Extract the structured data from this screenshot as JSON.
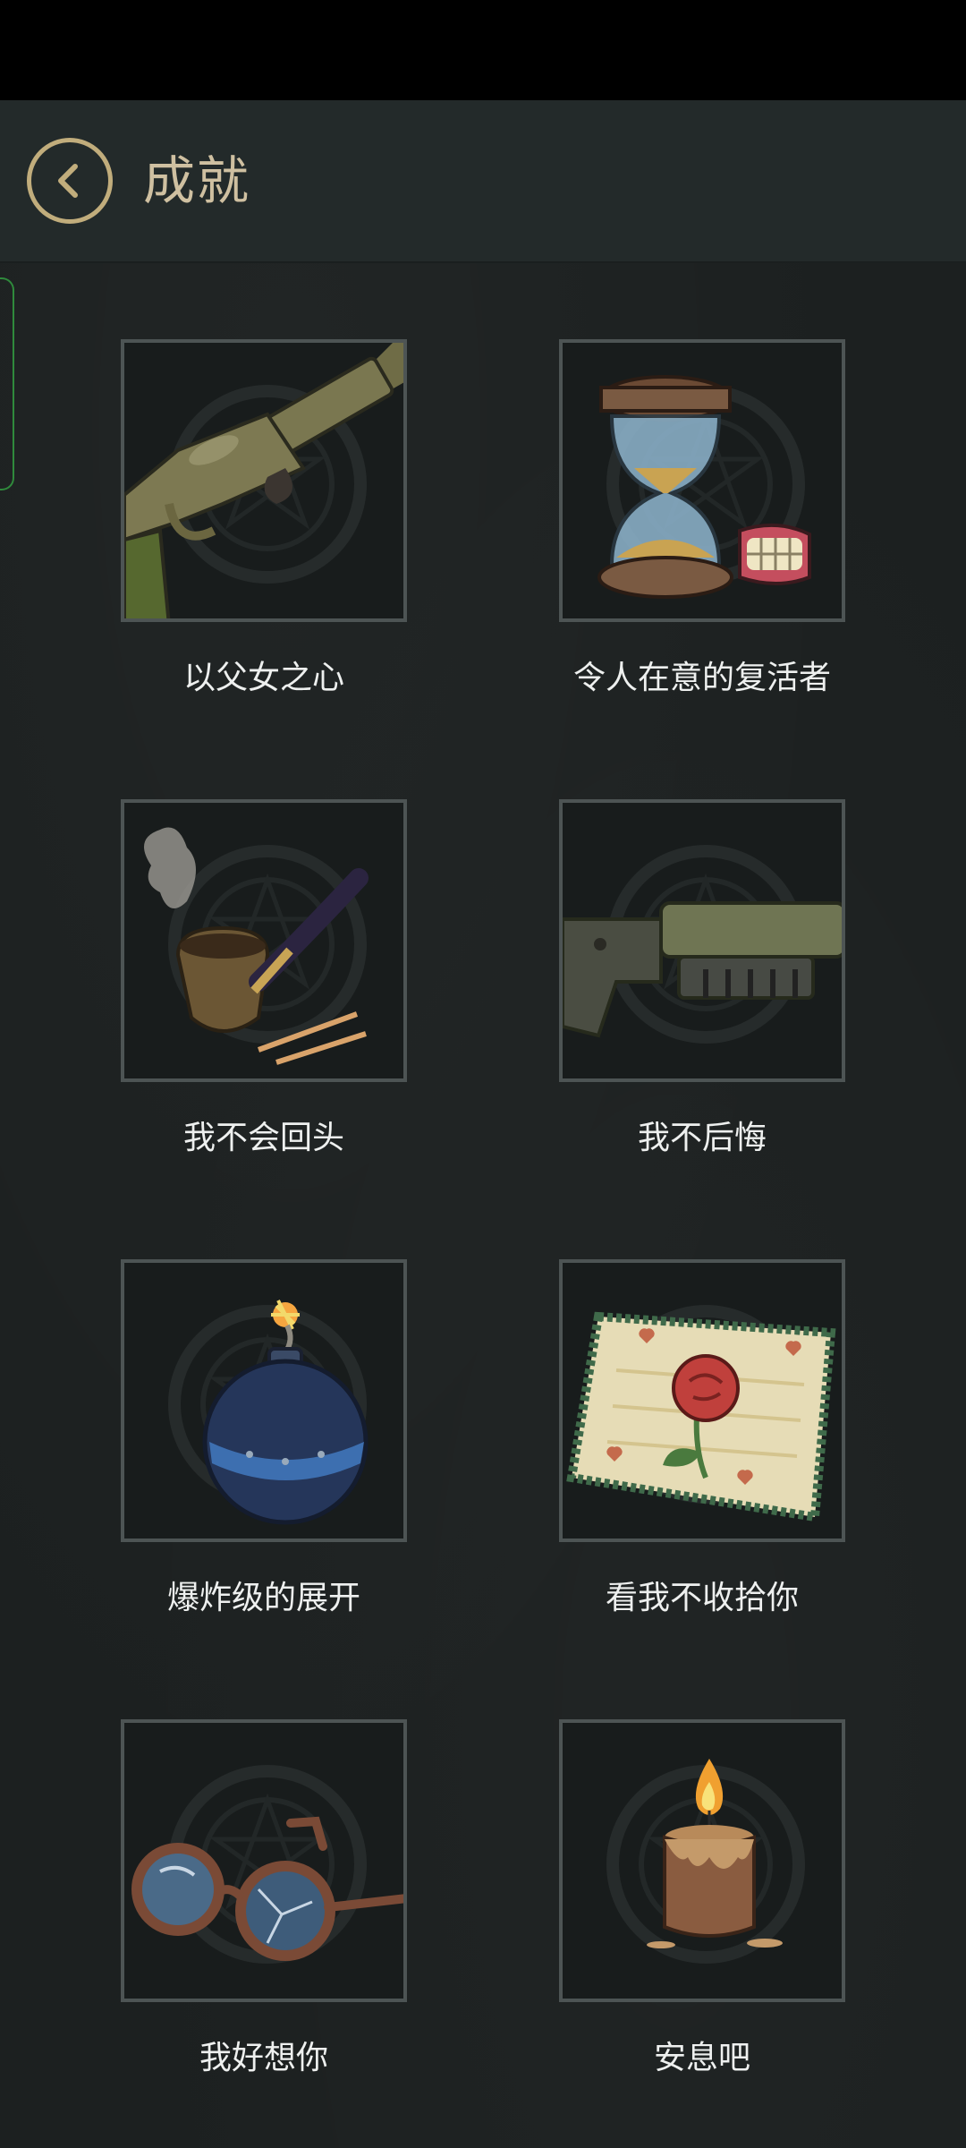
{
  "header": {
    "title": "成就"
  },
  "achievements": [
    {
      "label": "以父女之心",
      "icon": "shotgun-icon"
    },
    {
      "label": "令人在意的复活者",
      "icon": "hourglass-dentures-icon"
    },
    {
      "label": "我不会回头",
      "icon": "smoking-pipe-icon"
    },
    {
      "label": "我不后悔",
      "icon": "rifle-icon"
    },
    {
      "label": "爆炸级的展开",
      "icon": "bomb-icon"
    },
    {
      "label": "看我不收拾你",
      "icon": "rose-handkerchief-icon"
    },
    {
      "label": "我好想你",
      "icon": "broken-glasses-icon"
    },
    {
      "label": "安息吧",
      "icon": "candle-icon"
    }
  ],
  "colors": {
    "accent_gold": "#c1ad7c",
    "title_text": "#cfc0a1",
    "label_text": "#eef0ef",
    "side_tab_green": "#2f8a3c"
  }
}
